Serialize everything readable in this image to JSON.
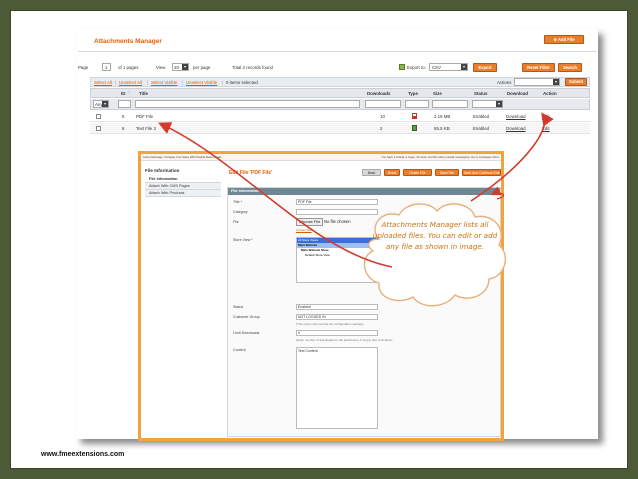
{
  "sheet": {
    "title": "Attachments Manager",
    "add_button": "Add File"
  },
  "pager": {
    "page_label": "Page",
    "page_value": "1",
    "of_pages": "of 1 pages",
    "view_label": "View",
    "view_value": "20",
    "per_page": "per page",
    "total": "Total 2 records found",
    "export_label": "Export to:",
    "export_value": "CSV",
    "export_button": "Export",
    "reset_button": "Reset Filter",
    "search_button": "Search"
  },
  "massaction": {
    "select_all": "Select All",
    "unselect_all": "Unselect All",
    "select_visible": "Select Visible",
    "unselect_visible": "Unselect Visible",
    "selected": "0 items selected",
    "actions_label": "Actions",
    "submit_button": "Submit"
  },
  "grid": {
    "headers": {
      "id": "ID",
      "title": "Title",
      "downloads": "Downloads",
      "type": "Type",
      "size": "Size",
      "status": "Status",
      "download": "Download",
      "action": "Action"
    },
    "filter_any": "Any",
    "rows": [
      {
        "id": "5",
        "title": "PDF File",
        "downloads": "10",
        "type_icon": "pdf-icon",
        "size": "2.15 MB",
        "status": "Enabled",
        "download": "Download",
        "action": "Edit"
      },
      {
        "id": "6",
        "title": "Text File 2",
        "downloads": "2",
        "type_icon": "text-file-icon",
        "size": "55.5 KB",
        "status": "Enabled",
        "download": "Download",
        "action": "Edit"
      }
    ]
  },
  "screenshot": {
    "top_left": "Latest Message: Increase Your Sales With PayPal Read details",
    "top_right": "You have 1 critical, 4 major, 33 minor and 96 notice unread message(s). Go to messages inbox",
    "side_heading": "File Information",
    "side_items": [
      "File Information",
      "Attach With CMS Pages",
      "Attach With Products"
    ],
    "edit_title": "Edit File 'PDF File'",
    "buttons": [
      "Back",
      "Reset",
      "Delete File",
      "Save File",
      "Save And Continue Edit"
    ],
    "section_header": "File Information",
    "fields": {
      "title_label": "Title *",
      "title_value": "PDF File",
      "category_label": "Category",
      "file_label": "File",
      "file_button": "Choose File",
      "file_none": "No file chosen",
      "file_link": "Current File",
      "store_label": "Store View *",
      "store_options": [
        "All Store Views",
        "Main Website",
        "Main Website Store",
        "Default Store View"
      ],
      "status_label": "Status",
      "status_value": "Enabled",
      "group_label": "Customer Group",
      "group_value": "NOT LOGGED IN",
      "group_hint": "(This option will override the configuration settings)",
      "limit_label": "Limit Downloads",
      "limit_value": "0",
      "limit_hint": "(Enter number of downloads for the attachment. If empty then unlimited.)",
      "content_label": "Content",
      "content_value": "Text Content"
    }
  },
  "callout": {
    "text": "Attachments Manager lists all uploaded files. You can edit or add any file as shown in image."
  },
  "footer": {
    "url": "www.fmeextensions.com"
  },
  "colors": {
    "accent": "#eb5e00",
    "frame_background": "#4d5a38",
    "highlight_border": "#f2a33a",
    "arrow": "#d33a2c"
  }
}
